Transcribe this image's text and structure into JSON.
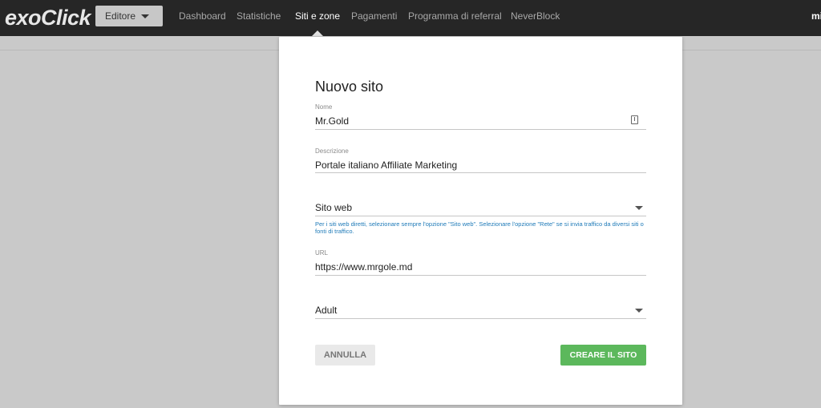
{
  "header": {
    "logo": "exoClick",
    "role_button": "Editore",
    "nav": [
      "Dashboard",
      "Statistiche",
      "Siti e zone",
      "Pagamenti",
      "Programma di referral",
      "NeverBlock"
    ],
    "active_nav": "Siti e zone",
    "user_partial": "mi"
  },
  "modal": {
    "title": "Nuovo sito",
    "name_label": "Nome",
    "name_value": "Mr.Gold",
    "description_label": "Descrizione",
    "description_value": "Portale italiano Affiliate Marketing",
    "type_value": "Sito web",
    "type_hint": "Per i siti web diretti, selezionare sempre l'opzione \"Sito web\". Selezionare l'opzione \"Rete\" se si invia traffico da diversi siti o fonti di traffico.",
    "url_label": "URL",
    "url_value": "https://www.mrgole.md",
    "category_value": "Adult",
    "cancel_label": "ANNULLA",
    "create_label": "CREARE IL SITO"
  },
  "colors": {
    "topbar": "#262626",
    "overlay": "#c9c9c9",
    "create_button": "#5cb85c",
    "hint_text": "#1e7ab8"
  }
}
